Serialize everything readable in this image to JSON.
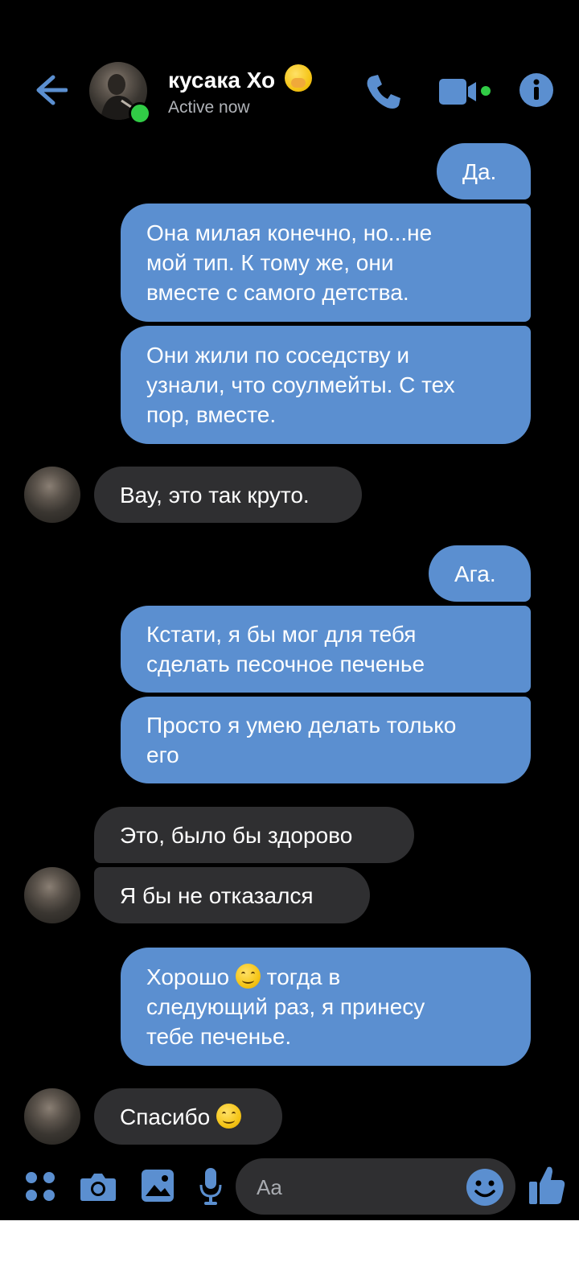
{
  "header": {
    "contact_name": "кусака Хо",
    "status": "Active now",
    "back_icon": "arrow-left-icon",
    "call_icon": "phone-icon",
    "video_icon": "video-camera-icon",
    "info_icon": "info-icon",
    "name_emoji": "🤭"
  },
  "messages": [
    {
      "id": "m1",
      "side": "out",
      "text": "Да."
    },
    {
      "id": "m2",
      "side": "out",
      "text": "Она милая конечно, но...не\nмой тип. К тому же, они\nвместе с самого детства."
    },
    {
      "id": "m3",
      "side": "out",
      "text": "Они жили по соседству и\nузнали, что соулмейты. С тех\nпор, вместе."
    },
    {
      "id": "m4",
      "side": "in",
      "text": "Вау, это так круто."
    },
    {
      "id": "m5",
      "side": "out",
      "text": "Ага."
    },
    {
      "id": "m6",
      "side": "out",
      "text": "Кстати, я бы мог для тебя\nсделать песочное печенье"
    },
    {
      "id": "m7",
      "side": "out",
      "text": "Просто я умею делать только\nего"
    },
    {
      "id": "m8",
      "side": "in",
      "text": "Это, было бы здорово"
    },
    {
      "id": "m9",
      "side": "in",
      "text": "Я бы не отказался"
    },
    {
      "id": "m10",
      "side": "out",
      "text_a": "Хорошо ",
      "text_b": " тогда в\nследующий раз, я принесу\nтебе печенье."
    },
    {
      "id": "m11",
      "side": "in",
      "text": "Спасибо "
    }
  ],
  "composer": {
    "placeholder": "Aa",
    "menu_icon": "four-dots-icon",
    "camera_icon": "camera-icon",
    "gallery_icon": "image-icon",
    "mic_icon": "microphone-icon",
    "emoji_icon": "smiley-icon",
    "like_icon": "thumbs-up-icon"
  },
  "colors": {
    "accent": "#5b8fd0",
    "incoming_bubble": "#2f2f31",
    "active_green": "#31cc46",
    "background": "#000000"
  }
}
